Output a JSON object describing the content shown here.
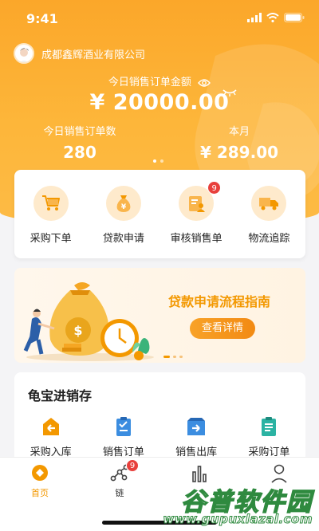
{
  "status_bar": {
    "time": "9:41"
  },
  "header": {
    "company_name": "成都鑫辉酒业有限公司",
    "today_amount_label": "今日销售订单金额",
    "today_amount_value": "¥ 20000.00",
    "today_count_label": "今日销售订单数",
    "today_count_value": "280",
    "month_label": "本月",
    "month_value": "¥ 289.00"
  },
  "quick_actions": [
    {
      "label": "采购下单",
      "icon": "shopping-cart-icon"
    },
    {
      "label": "贷款申请",
      "icon": "money-bag-icon"
    },
    {
      "label": "审核销售单",
      "icon": "audit-document-icon",
      "badge": "9"
    },
    {
      "label": "物流追踪",
      "icon": "delivery-truck-icon"
    }
  ],
  "banner": {
    "title": "贷款申请流程指南",
    "button_label": "查看详情"
  },
  "inventory": {
    "title": "龟宝进销存",
    "items": [
      {
        "label": "采购入库",
        "icon": "purchase-in-icon"
      },
      {
        "label": "销售订单",
        "icon": "sales-order-icon"
      },
      {
        "label": "销售出库",
        "icon": "sales-out-icon"
      },
      {
        "label": "采购订单",
        "icon": "purchase-order-icon"
      }
    ]
  },
  "tabbar": [
    {
      "label": "首页",
      "icon": "home-icon",
      "active": true
    },
    {
      "label": "链",
      "icon": "chain-icon",
      "badge": "9"
    },
    {
      "label": "",
      "icon": "report-icon"
    },
    {
      "label": "",
      "icon": "profile-icon"
    }
  ],
  "watermark": {
    "brand": "谷普软件园",
    "url": "www.gupuxlazal.com"
  },
  "colors": {
    "primary": "#f39800",
    "header_bg": "#fbaa2e",
    "badge": "#e8403c",
    "icon_bg": "#feeacc"
  }
}
